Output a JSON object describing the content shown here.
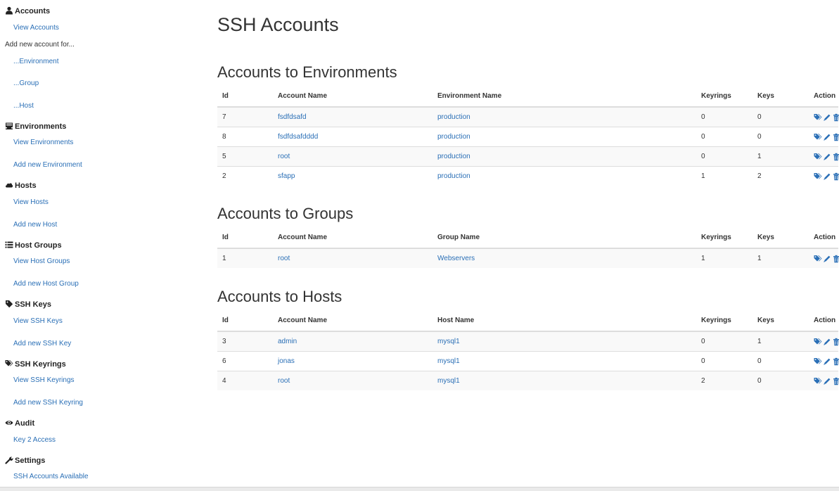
{
  "sidebar": {
    "accounts": {
      "title": "Accounts",
      "view": "View Accounts",
      "add_text": "Add new account for...",
      "env": "...Environment",
      "group": "...Group",
      "host": "...Host"
    },
    "environments": {
      "title": "Environments",
      "view": "View Environments",
      "add": "Add new Environment"
    },
    "hosts": {
      "title": "Hosts",
      "view": "View Hosts",
      "add": "Add new Host"
    },
    "host_groups": {
      "title": "Host Groups",
      "view": "View Host Groups",
      "add": "Add new Host Group"
    },
    "ssh_keys": {
      "title": "SSH Keys",
      "view": "View SSH Keys",
      "add": "Add new SSH Key"
    },
    "ssh_keyrings": {
      "title": "SSH Keyrings",
      "view": "View SSH Keyrings",
      "add": "Add new SSH Keyring"
    },
    "audit": {
      "title": "Audit",
      "link": "Key 2 Access"
    },
    "settings": {
      "title": "Settings",
      "link": "SSH Accounts Available"
    }
  },
  "icons": {
    "accounts": "user-icon",
    "environments": "server-icon",
    "hosts": "cloud-icon",
    "host_groups": "list-icon",
    "ssh_keys": "tag-icon",
    "ssh_keyrings": "tags-icon",
    "audit": "eye-icon",
    "settings": "wrench-icon",
    "actions": [
      "tags-icon",
      "pencil-icon",
      "trash-icon"
    ]
  },
  "colors": {
    "link": "#2a6fb6",
    "text": "#333333",
    "stripe": "#f9f9f9",
    "border": "#dddddd"
  },
  "page": {
    "title": "SSH Accounts"
  },
  "env_table": {
    "heading": "Accounts to Environments",
    "columns": [
      "Id",
      "Account Name",
      "Environment Name",
      "Keyrings",
      "Keys",
      "Action"
    ],
    "rows": [
      {
        "id": "7",
        "account": "fsdfdsafd",
        "target": "production",
        "keyrings": "0",
        "keys": "0"
      },
      {
        "id": "8",
        "account": "fsdfdsafdddd",
        "target": "production",
        "keyrings": "0",
        "keys": "0"
      },
      {
        "id": "5",
        "account": "root",
        "target": "production",
        "keyrings": "0",
        "keys": "1"
      },
      {
        "id": "2",
        "account": "sfapp",
        "target": "production",
        "keyrings": "1",
        "keys": "2"
      }
    ]
  },
  "group_table": {
    "heading": "Accounts to Groups",
    "columns": [
      "Id",
      "Account Name",
      "Group Name",
      "Keyrings",
      "Keys",
      "Action"
    ],
    "rows": [
      {
        "id": "1",
        "account": "root",
        "target": "Webservers",
        "keyrings": "1",
        "keys": "1"
      }
    ]
  },
  "host_table": {
    "heading": "Accounts to Hosts",
    "columns": [
      "Id",
      "Account Name",
      "Host Name",
      "Keyrings",
      "Keys",
      "Action"
    ],
    "rows": [
      {
        "id": "3",
        "account": "admin",
        "target": "mysql1",
        "keyrings": "0",
        "keys": "1"
      },
      {
        "id": "6",
        "account": "jonas",
        "target": "mysql1",
        "keyrings": "0",
        "keys": "0"
      },
      {
        "id": "4",
        "account": "root",
        "target": "mysql1",
        "keyrings": "2",
        "keys": "0"
      }
    ]
  }
}
